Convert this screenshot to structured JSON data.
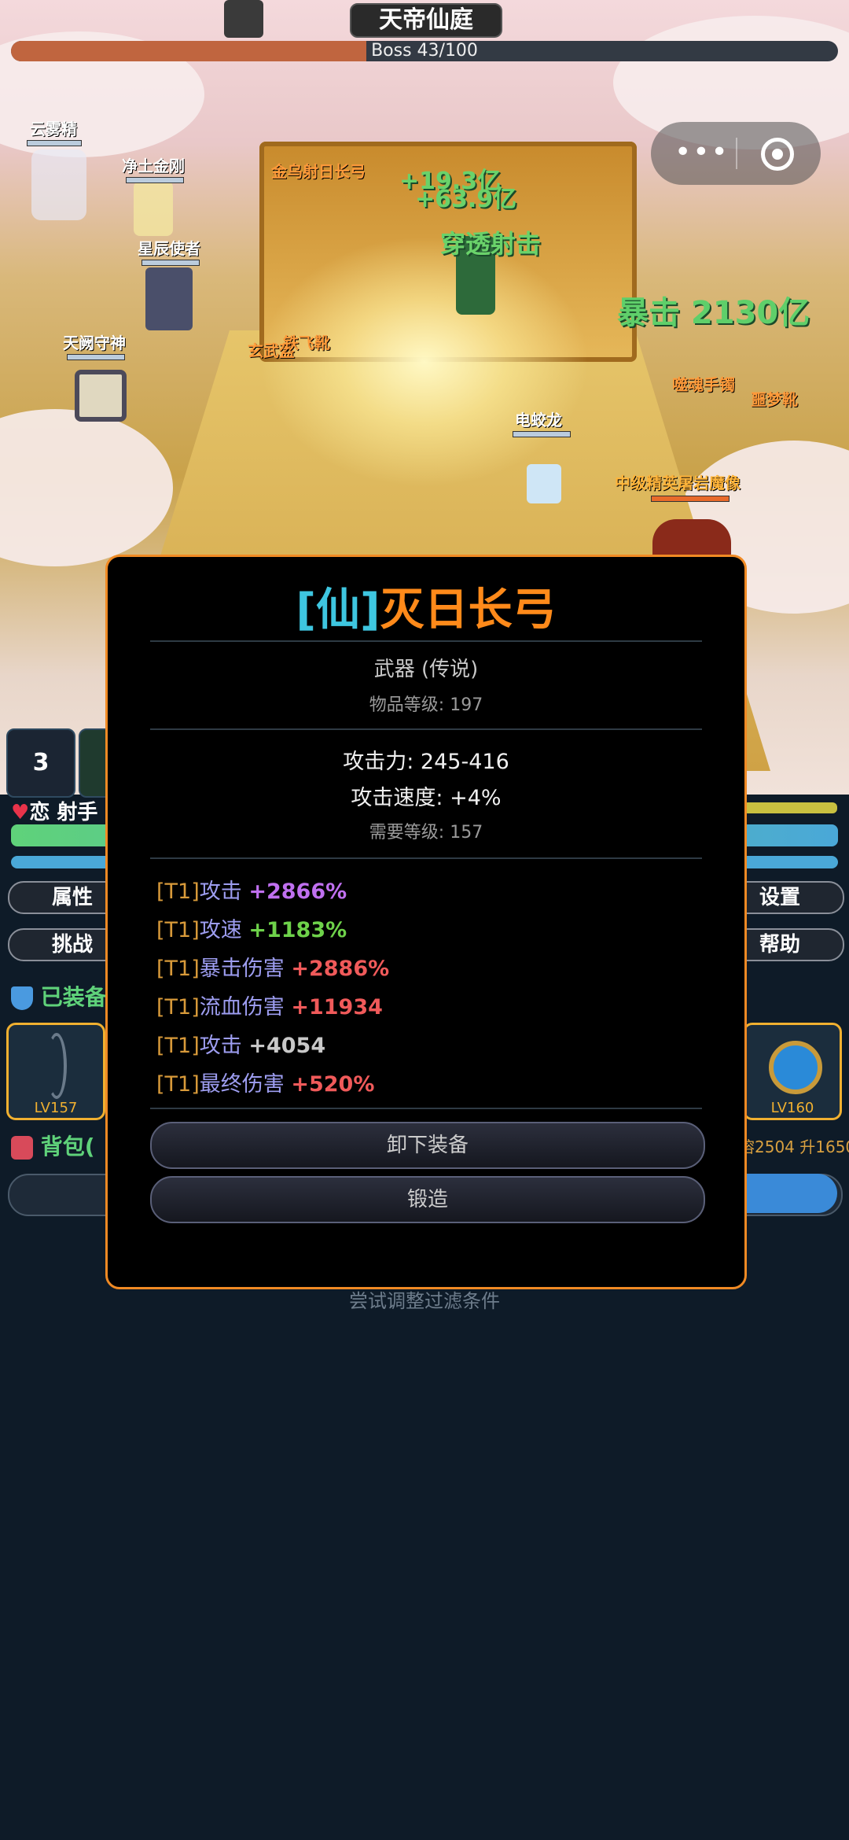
{
  "boss": {
    "title": "天帝仙庭",
    "label": "Boss 43/100",
    "progress": 0.43
  },
  "scene": {
    "units": [
      {
        "name": "云雾精",
        "color": "#ffffff"
      },
      {
        "name": "净土金刚",
        "color": "#ffffff"
      },
      {
        "name": "星辰使者",
        "color": "#ffffff"
      },
      {
        "name": "天阙守神",
        "color": "#ffffff"
      },
      {
        "name": "金乌射日长弓",
        "color": "#ff9a3a"
      },
      {
        "name": "玄武盔",
        "color": "#ff9a3a"
      },
      {
        "name": "铁飞靴",
        "color": "#ff9a3a"
      },
      {
        "name": "电蛟龙",
        "color": "#ffffff"
      },
      {
        "name": "噬魂手镯",
        "color": "#ff9a3a"
      },
      {
        "name": "噩梦靴",
        "color": "#ff9a3a"
      },
      {
        "name": "中级精英屠岩魔像",
        "color": "#ffb43a"
      }
    ],
    "floating": {
      "skill": "穿透射击",
      "crit": "暴击 2130亿",
      "dmg1": "+19.3亿",
      "dmg2": "+63.9亿"
    }
  },
  "hud": {
    "skill_count": "3",
    "char_name": "恋 射手",
    "tab_attr": "属性",
    "tab_challenge": "挑战",
    "tab_settings": "设置",
    "tab_help": "帮助",
    "equipped_label": "已装备",
    "bag_label": "背包(",
    "slot_left_lv": "LV157",
    "slot_right_lv": "LV160",
    "stats_right": "溶2504 升1650"
  },
  "modal": {
    "title_prefix": "[仙]",
    "title_main": "灭日长弓",
    "type": "武器 (传说)",
    "item_level": "物品等级: 197",
    "attack": "攻击力: 245-416",
    "speed": "攻击速度: +4%",
    "req_level": "需要等级: 157",
    "affixes": [
      {
        "tier": "[T1]",
        "name": "攻击",
        "value": "+2866%",
        "color": "#c070f0"
      },
      {
        "tier": "[T1]",
        "name": "攻速",
        "value": "+1183%",
        "color": "#6ed24a"
      },
      {
        "tier": "[T1]",
        "name": "暴击伤害",
        "value": "+2886%",
        "color": "#f05a5a"
      },
      {
        "tier": "[T1]",
        "name": "流血伤害",
        "value": "+11934",
        "color": "#f05a5a"
      },
      {
        "tier": "[T1]",
        "name": "攻击",
        "value": "+4054",
        "color": "#c8c8c8"
      },
      {
        "tier": "[T1]",
        "name": "最终伤害",
        "value": "+520%",
        "color": "#f05a5a"
      }
    ],
    "btn_unequip": "卸下装备",
    "btn_forge": "锻造"
  },
  "hint": "尝试调整过滤条件"
}
